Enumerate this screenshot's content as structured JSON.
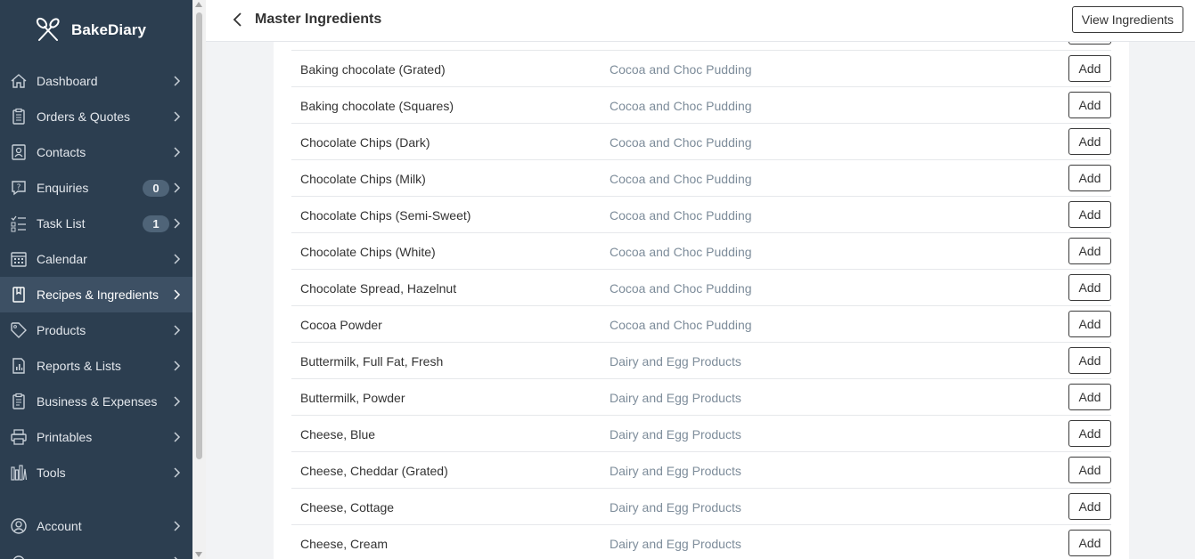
{
  "app": {
    "name": "BakeDiary"
  },
  "sidebar": {
    "items": [
      {
        "label": "Dashboard",
        "icon": "home-icon"
      },
      {
        "label": "Orders & Quotes",
        "icon": "clipboard-icon"
      },
      {
        "label": "Contacts",
        "icon": "contact-icon"
      },
      {
        "label": "Enquiries",
        "icon": "question-icon",
        "badge": "0"
      },
      {
        "label": "Task List",
        "icon": "checklist-icon",
        "badge": "1"
      },
      {
        "label": "Calendar",
        "icon": "calendar-icon"
      },
      {
        "label": "Recipes & Ingredients",
        "icon": "book-icon",
        "active": true
      },
      {
        "label": "Products",
        "icon": "tag-icon"
      },
      {
        "label": "Reports & Lists",
        "icon": "report-icon"
      },
      {
        "label": "Business & Expenses",
        "icon": "ledger-icon"
      },
      {
        "label": "Printables",
        "icon": "printer-icon"
      },
      {
        "label": "Tools",
        "icon": "tools-icon"
      }
    ],
    "account": {
      "label": "Account",
      "icon": "user-circle-icon"
    }
  },
  "header": {
    "title": "Master Ingredients",
    "view_button": "View Ingredients"
  },
  "table": {
    "add_label": "Add",
    "rows": [
      {
        "ingredient": "Baking chocolate (Grated)",
        "category": "Cocoa and Choc Pudding"
      },
      {
        "ingredient": "Baking chocolate (Squares)",
        "category": "Cocoa and Choc Pudding"
      },
      {
        "ingredient": "Chocolate Chips (Dark)",
        "category": "Cocoa and Choc Pudding"
      },
      {
        "ingredient": "Chocolate Chips (Milk)",
        "category": "Cocoa and Choc Pudding"
      },
      {
        "ingredient": "Chocolate Chips (Semi-Sweet)",
        "category": "Cocoa and Choc Pudding"
      },
      {
        "ingredient": "Chocolate Chips (White)",
        "category": "Cocoa and Choc Pudding"
      },
      {
        "ingredient": "Chocolate Spread, Hazelnut",
        "category": "Cocoa and Choc Pudding"
      },
      {
        "ingredient": "Cocoa Powder",
        "category": "Cocoa and Choc Pudding"
      },
      {
        "ingredient": "Buttermilk, Full Fat, Fresh",
        "category": "Dairy and Egg Products"
      },
      {
        "ingredient": "Buttermilk, Powder",
        "category": "Dairy and Egg Products"
      },
      {
        "ingredient": "Cheese, Blue",
        "category": "Dairy and Egg Products"
      },
      {
        "ingredient": "Cheese, Cheddar (Grated)",
        "category": "Dairy and Egg Products"
      },
      {
        "ingredient": "Cheese, Cottage",
        "category": "Dairy and Egg Products"
      },
      {
        "ingredient": "Cheese, Cream",
        "category": "Dairy and Egg Products"
      }
    ]
  },
  "colors": {
    "sidebar_bg": "#2c3e50",
    "sidebar_active": "#3d5064",
    "category_text": "#7d8c9a"
  }
}
